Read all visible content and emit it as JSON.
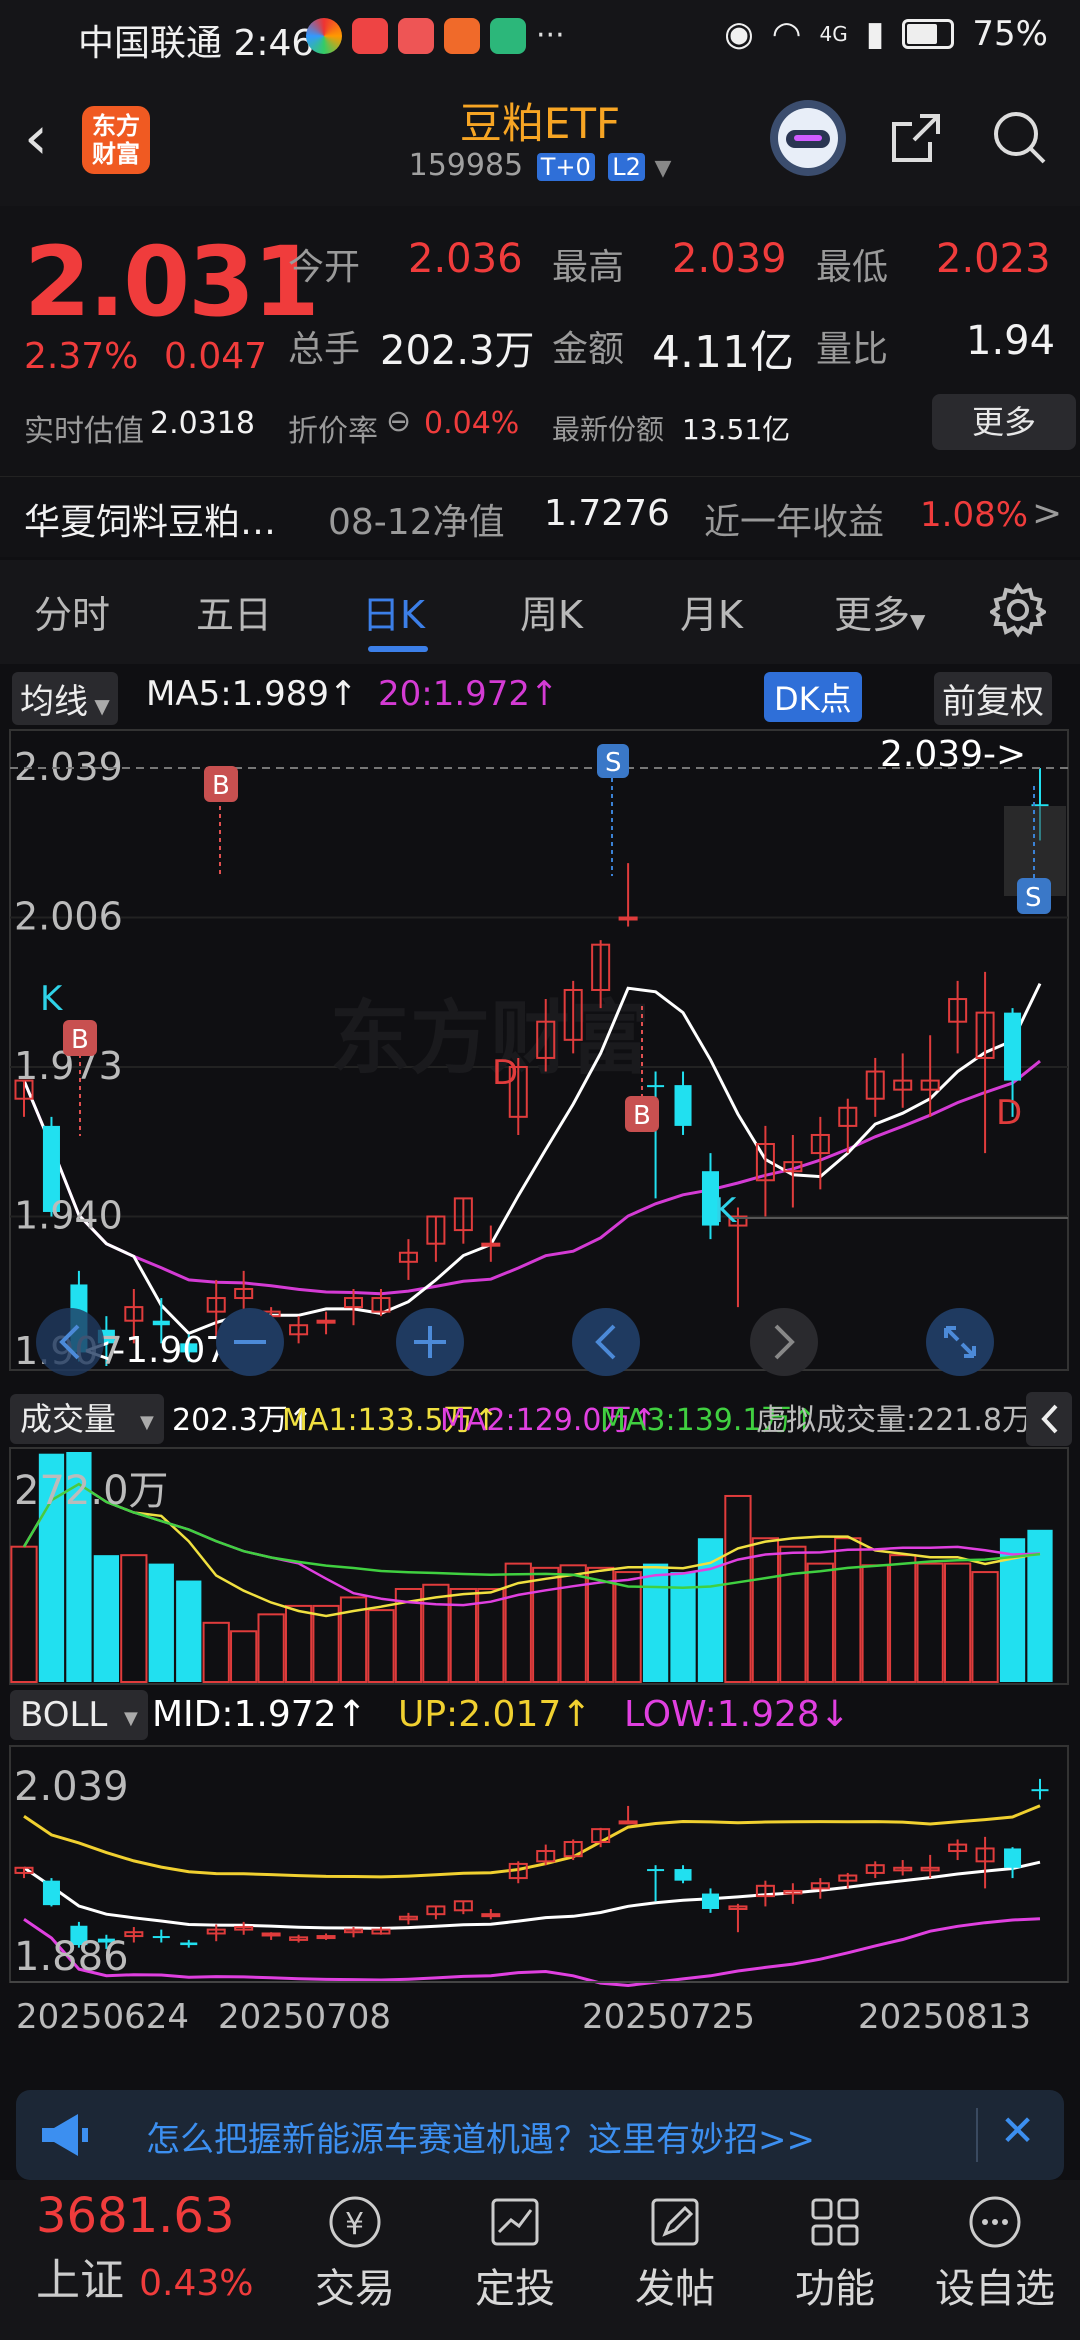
{
  "status_bar": {
    "carrier_time": "中国联通 2:46",
    "more_dots": "···",
    "network": "4G",
    "battery": "75%"
  },
  "header": {
    "logo_text_1": "东方",
    "logo_text_2": "财富",
    "title": "豆粕ETF",
    "code": "159985",
    "tag_t0": "T+0",
    "tag_l2": "L2"
  },
  "quote": {
    "price": "2.031",
    "change_pct": "2.37%",
    "change": "0.047",
    "open_label": "今开",
    "open": "2.036",
    "high_label": "最高",
    "high": "2.039",
    "low_label": "最低",
    "low": "2.023",
    "volume_label": "总手",
    "volume": "202.3万",
    "amount_label": "金额",
    "amount": "4.11亿",
    "ratio_label": "量比",
    "ratio": "1.94",
    "est_label": "实时估值",
    "est": "2.0318",
    "discount_label": "折价率",
    "discount": "0.04%",
    "shares_label": "最新份额",
    "shares": "13.51亿",
    "more_button": "更多"
  },
  "fund": {
    "name": "华夏饲料豆粕…",
    "nav_label": "08-12净值",
    "nav": "1.7276",
    "yield_label": "近一年收益",
    "yield": "1.08%",
    "arrow": ">"
  },
  "tabs": [
    "分时",
    "五日",
    "日K",
    "周K",
    "月K",
    "更多"
  ],
  "chart_bar": {
    "ma_button": "均线",
    "ma5": "MA5:1.989↑",
    "ma20": "20:1.972↑",
    "dk_button": "DK点",
    "adjust_button": "前复权"
  },
  "volume_bar": {
    "label": "成交量",
    "vol": "202.3万↑",
    "ma1": "MA1:133.5万↑",
    "ma2": "MA2:129.0万↑",
    "ma3": "MA3:139.1万↑",
    "virtual": "虚拟成交量:221.8万",
    "top_tick": "272.0万"
  },
  "boll_bar": {
    "label": "BOLL",
    "mid": "MID:1.972↑",
    "up": "UP:2.017↑",
    "low": "LOW:1.928↓",
    "top_tick": "2.039",
    "bottom_tick": "1.886"
  },
  "price_chart": {
    "ticks": [
      "2.039",
      "2.006",
      "1.973",
      "1.940",
      "1.907"
    ],
    "max_annotation": "2.039->",
    "min_annotation": "<-1.907",
    "dates": [
      "20250624",
      "20250708",
      "20250725",
      "20250813"
    ],
    "watermark": "东方财富",
    "marker_labels": [
      "S",
      "B",
      "K",
      "D"
    ]
  },
  "chart_data": {
    "type": "candlestick",
    "dates_shown": [
      "20250624",
      "20250708",
      "20250725",
      "20250813"
    ],
    "y_range": [
      1.907,
      2.039
    ],
    "candles": [
      {
        "o": 1.966,
        "h": 1.97,
        "l": 1.962,
        "c": 1.97,
        "dir": "up"
      },
      {
        "o": 1.96,
        "h": 1.962,
        "l": 1.94,
        "c": 1.941,
        "dir": "down"
      },
      {
        "o": 1.925,
        "h": 1.928,
        "l": 1.908,
        "c": 1.91,
        "dir": "down"
      },
      {
        "o": 1.912,
        "h": 1.918,
        "l": 1.907,
        "c": 1.915,
        "dir": "down"
      },
      {
        "o": 1.917,
        "h": 1.924,
        "l": 1.912,
        "c": 1.92,
        "dir": "up"
      },
      {
        "o": 1.917,
        "h": 1.922,
        "l": 1.912,
        "c": 1.916,
        "dir": "down"
      },
      {
        "o": 1.912,
        "h": 1.914,
        "l": 1.908,
        "c": 1.91,
        "dir": "down"
      },
      {
        "o": 1.919,
        "h": 1.926,
        "l": 1.913,
        "c": 1.922,
        "dir": "up"
      },
      {
        "o": 1.922,
        "h": 1.928,
        "l": 1.918,
        "c": 1.924,
        "dir": "up"
      },
      {
        "o": 1.918,
        "h": 1.92,
        "l": 1.914,
        "c": 1.919,
        "dir": "up"
      },
      {
        "o": 1.914,
        "h": 1.918,
        "l": 1.912,
        "c": 1.916,
        "dir": "up"
      },
      {
        "o": 1.917,
        "h": 1.919,
        "l": 1.914,
        "c": 1.917,
        "dir": "up"
      },
      {
        "o": 1.92,
        "h": 1.924,
        "l": 1.916,
        "c": 1.922,
        "dir": "up"
      },
      {
        "o": 1.922,
        "h": 1.924,
        "l": 1.918,
        "c": 1.919,
        "dir": "up"
      },
      {
        "o": 1.93,
        "h": 1.935,
        "l": 1.926,
        "c": 1.932,
        "dir": "up"
      },
      {
        "o": 1.934,
        "h": 1.94,
        "l": 1.93,
        "c": 1.94,
        "dir": "up"
      },
      {
        "o": 1.937,
        "h": 1.944,
        "l": 1.934,
        "c": 1.944,
        "dir": "up"
      },
      {
        "o": 1.934,
        "h": 1.938,
        "l": 1.93,
        "c": 1.934,
        "dir": "up"
      },
      {
        "o": 1.962,
        "h": 1.975,
        "l": 1.958,
        "c": 1.973,
        "dir": "up"
      },
      {
        "o": 1.975,
        "h": 1.988,
        "l": 1.972,
        "c": 1.983,
        "dir": "up"
      },
      {
        "o": 1.979,
        "h": 1.992,
        "l": 1.976,
        "c": 1.99,
        "dir": "up"
      },
      {
        "o": 1.99,
        "h": 2.001,
        "l": 1.986,
        "c": 2.0,
        "dir": "up"
      },
      {
        "o": 2.006,
        "h": 2.018,
        "l": 2.004,
        "c": 2.006,
        "dir": "up"
      },
      {
        "o": 1.969,
        "h": 1.972,
        "l": 1.944,
        "c": 1.969,
        "dir": "down"
      },
      {
        "o": 1.969,
        "h": 1.972,
        "l": 1.958,
        "c": 1.96,
        "dir": "down"
      },
      {
        "o": 1.95,
        "h": 1.954,
        "l": 1.935,
        "c": 1.938,
        "dir": "down"
      },
      {
        "o": 1.938,
        "h": 1.942,
        "l": 1.92,
        "c": 1.94,
        "dir": "up"
      },
      {
        "o": 1.948,
        "h": 1.96,
        "l": 1.94,
        "c": 1.956,
        "dir": "up"
      },
      {
        "o": 1.95,
        "h": 1.958,
        "l": 1.942,
        "c": 1.952,
        "dir": "up"
      },
      {
        "o": 1.954,
        "h": 1.962,
        "l": 1.946,
        "c": 1.958,
        "dir": "up"
      },
      {
        "o": 1.96,
        "h": 1.966,
        "l": 1.954,
        "c": 1.964,
        "dir": "up"
      },
      {
        "o": 1.966,
        "h": 1.975,
        "l": 1.962,
        "c": 1.972,
        "dir": "up"
      },
      {
        "o": 1.97,
        "h": 1.976,
        "l": 1.964,
        "c": 1.968,
        "dir": "up"
      },
      {
        "o": 1.97,
        "h": 1.98,
        "l": 1.962,
        "c": 1.968,
        "dir": "up"
      },
      {
        "o": 1.983,
        "h": 1.992,
        "l": 1.976,
        "c": 1.988,
        "dir": "up"
      },
      {
        "o": 1.975,
        "h": 1.994,
        "l": 1.954,
        "c": 1.985,
        "dir": "up"
      },
      {
        "o": 1.97,
        "h": 1.986,
        "l": 1.962,
        "c": 1.985,
        "dir": "down"
      },
      {
        "o": 2.031,
        "h": 2.039,
        "l": 2.023,
        "c": 2.031,
        "dir": "down"
      }
    ],
    "volume_max": "272.0万",
    "volume_values": [
      160,
      270,
      272,
      150,
      150,
      140,
      120,
      70,
      60,
      80,
      90,
      90,
      100,
      85,
      110,
      115,
      110,
      110,
      140,
      135,
      138,
      135,
      130,
      140,
      130,
      170,
      220,
      170,
      160,
      140,
      170,
      138,
      150,
      140,
      140,
      130,
      170,
      180
    ]
  },
  "ad": {
    "text": "怎么把握新能源车赛道机遇？这里有妙招>>"
  },
  "bottom_nav": {
    "index_value": "3681.63",
    "index_name": "上证",
    "index_change": "0.43%",
    "items": [
      "交易",
      "定投",
      "发帖",
      "功能",
      "设自选"
    ]
  }
}
